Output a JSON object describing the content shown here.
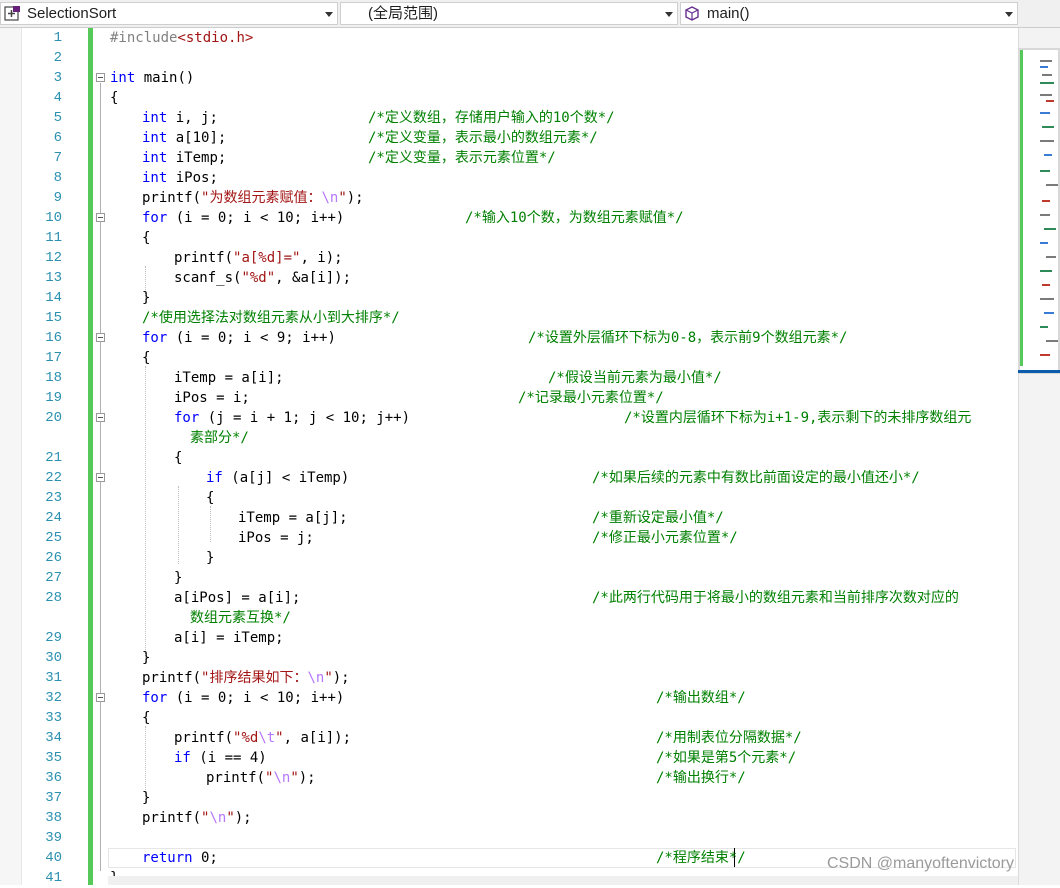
{
  "nav": {
    "project": "SelectionSort",
    "scope": "(全局范围)",
    "member": "main()"
  },
  "line_numbers": [
    "1",
    "2",
    "3",
    "4",
    "5",
    "6",
    "7",
    "8",
    "9",
    "10",
    "11",
    "12",
    "13",
    "14",
    "15",
    "16",
    "17",
    "18",
    "19",
    "20",
    "21",
    "22",
    "23",
    "24",
    "25",
    "26",
    "27",
    "28",
    "29",
    "30",
    "31",
    "32",
    "33",
    "34",
    "35",
    "36",
    "37",
    "38",
    "39",
    "40",
    "41"
  ],
  "code": {
    "l1": "#include",
    "l1b": "<stdio.h>",
    "l3a": "int",
    "l3b": " main()",
    "l4": "{",
    "l5a": "int",
    "l5b": " i, j;",
    "l5c": "/*定义数组，存储用户输入的10个数*/",
    "l6a": "int",
    "l6b": " a[10];",
    "l6c": "/*定义变量，表示最小的数组元素*/",
    "l7a": "int",
    "l7b": " iTemp;",
    "l7c": "/*定义变量，表示元素位置*/",
    "l8a": "int",
    "l8b": " iPos;",
    "l9a": "printf(",
    "l9b": "\"为数组元素赋值：",
    "l9c": "\\n",
    "l9d": "\"",
    "l9e": ");",
    "l10a": "for",
    "l10b": " (i = 0; i < 10; i++)",
    "l10c": "/*输入10个数，为数组元素赋值*/",
    "l11": "{",
    "l12a": "printf(",
    "l12b": "\"a[%d]=\"",
    "l12c": ", i);",
    "l13a": "scanf_s(",
    "l13b": "\"%d\"",
    "l13c": ", &a[i]);",
    "l14": "}",
    "l15": "/*使用选择法对数组元素从小到大排序*/",
    "l16a": "for",
    "l16b": " (i = 0; i < 9; i++)",
    "l16c": "/*设置外层循环下标为0-8，表示前9个数组元素*/",
    "l17": "{",
    "l18a": "iTemp = a[i];",
    "l18c": "/*假设当前元素为最小值*/",
    "l19a": "iPos = i;",
    "l19c": "/*记录最小元素位置*/",
    "l20a": "for",
    "l20b": " (j = i + 1; j < 10; j++)",
    "l20c": "/*设置内层循环下标为i+1-9,表示剩下的未排序数组元",
    "l20d": "素部分*/",
    "l21": "{",
    "l22a": "if",
    "l22b": " (a[j] < iTemp)",
    "l22c": "/*如果后续的元素中有数比前面设定的最小值还小*/",
    "l23": "{",
    "l24a": "iTemp = a[j];",
    "l24c": "/*重新设定最小值*/",
    "l25a": "iPos = j;",
    "l25c": "/*修正最小元素位置*/",
    "l26": "}",
    "l27": "}",
    "l28a": "a[iPos] = a[i];",
    "l28c": "/*此两行代码用于将最小的数组元素和当前排序次数对应的",
    "l28d": "数组元素互换*/",
    "l29": "a[i] = iTemp;",
    "l30": "}",
    "l31a": "printf(",
    "l31b": "\"排序结果如下：",
    "l31c": "\\n",
    "l31d": "\"",
    "l31e": ");",
    "l32a": "for",
    "l32b": " (i = 0; i < 10; i++)",
    "l32c": "/*输出数组*/",
    "l33": "{",
    "l34a": "printf(",
    "l34b": "\"%d",
    "l34bb": "\\t",
    "l34bc": "\"",
    "l34c": ", a[i]);",
    "l34d": "/*用制表位分隔数据*/",
    "l35a": "if",
    "l35b": " (i == 4)",
    "l35c": "/*如果是第5个元素*/",
    "l36a": "printf(",
    "l36b": "\"",
    "l36bb": "\\n",
    "l36bc": "\"",
    "l36c": ");",
    "l36d": "/*输出换行*/",
    "l37": "}",
    "l38a": "printf(",
    "l38b": "\"",
    "l38bb": "\\n",
    "l38bc": "\"",
    "l38c": ");",
    "l40a": "return",
    "l40b": " 0;",
    "l40c": "/*程序结束*/",
    "l41": "}"
  },
  "watermark": "CSDN @manyoftenvictory",
  "colors": {
    "keyword": "#0000ff",
    "string": "#a31515",
    "comment": "#008000",
    "line_number": "#2b91af",
    "change_bar": "#57c95a"
  }
}
